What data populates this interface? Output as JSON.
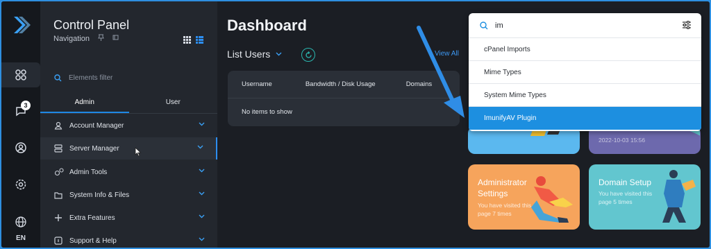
{
  "rail": {
    "notification_count": "3",
    "language": "EN"
  },
  "nav": {
    "title": "Control Panel",
    "subtitle": "Navigation",
    "filter_placeholder": "Elements filter",
    "tabs": [
      "Admin",
      "User"
    ],
    "items": [
      {
        "label": "Account Manager",
        "icon": "user-icon"
      },
      {
        "label": "Server Manager",
        "icon": "server-icon"
      },
      {
        "label": "Admin Tools",
        "icon": "gears-icon"
      },
      {
        "label": "System Info & Files",
        "icon": "folder-icon"
      },
      {
        "label": "Extra Features",
        "icon": "plus-icon"
      },
      {
        "label": "Support & Help",
        "icon": "help-icon"
      }
    ]
  },
  "main": {
    "title": "Dashboard",
    "list_users": "List Users",
    "view_all": "View All",
    "columns": [
      "Username",
      "Bandwidth / Disk Usage",
      "Domains"
    ],
    "empty": "No items to show"
  },
  "cards": {
    "top_right_date": "2022-10-03 15:56",
    "admin_title": "Administrator Settings",
    "admin_text": "You have visited this page 7 times",
    "domain_title": "Domain Setup",
    "domain_text": "You have visited this page 5 times"
  },
  "search": {
    "value": "im",
    "results": [
      "cPanel Imports",
      "Mime Types",
      "System Mime Types",
      "ImunifyAV Plugin"
    ],
    "selected": "ImunifyAV Plugin"
  },
  "colors": {
    "accent": "#1d8fe0",
    "card_blue": "#5bb8ef",
    "card_purple": "#6d69ad",
    "card_orange": "#f6a45c",
    "card_teal": "#62c6cf"
  }
}
